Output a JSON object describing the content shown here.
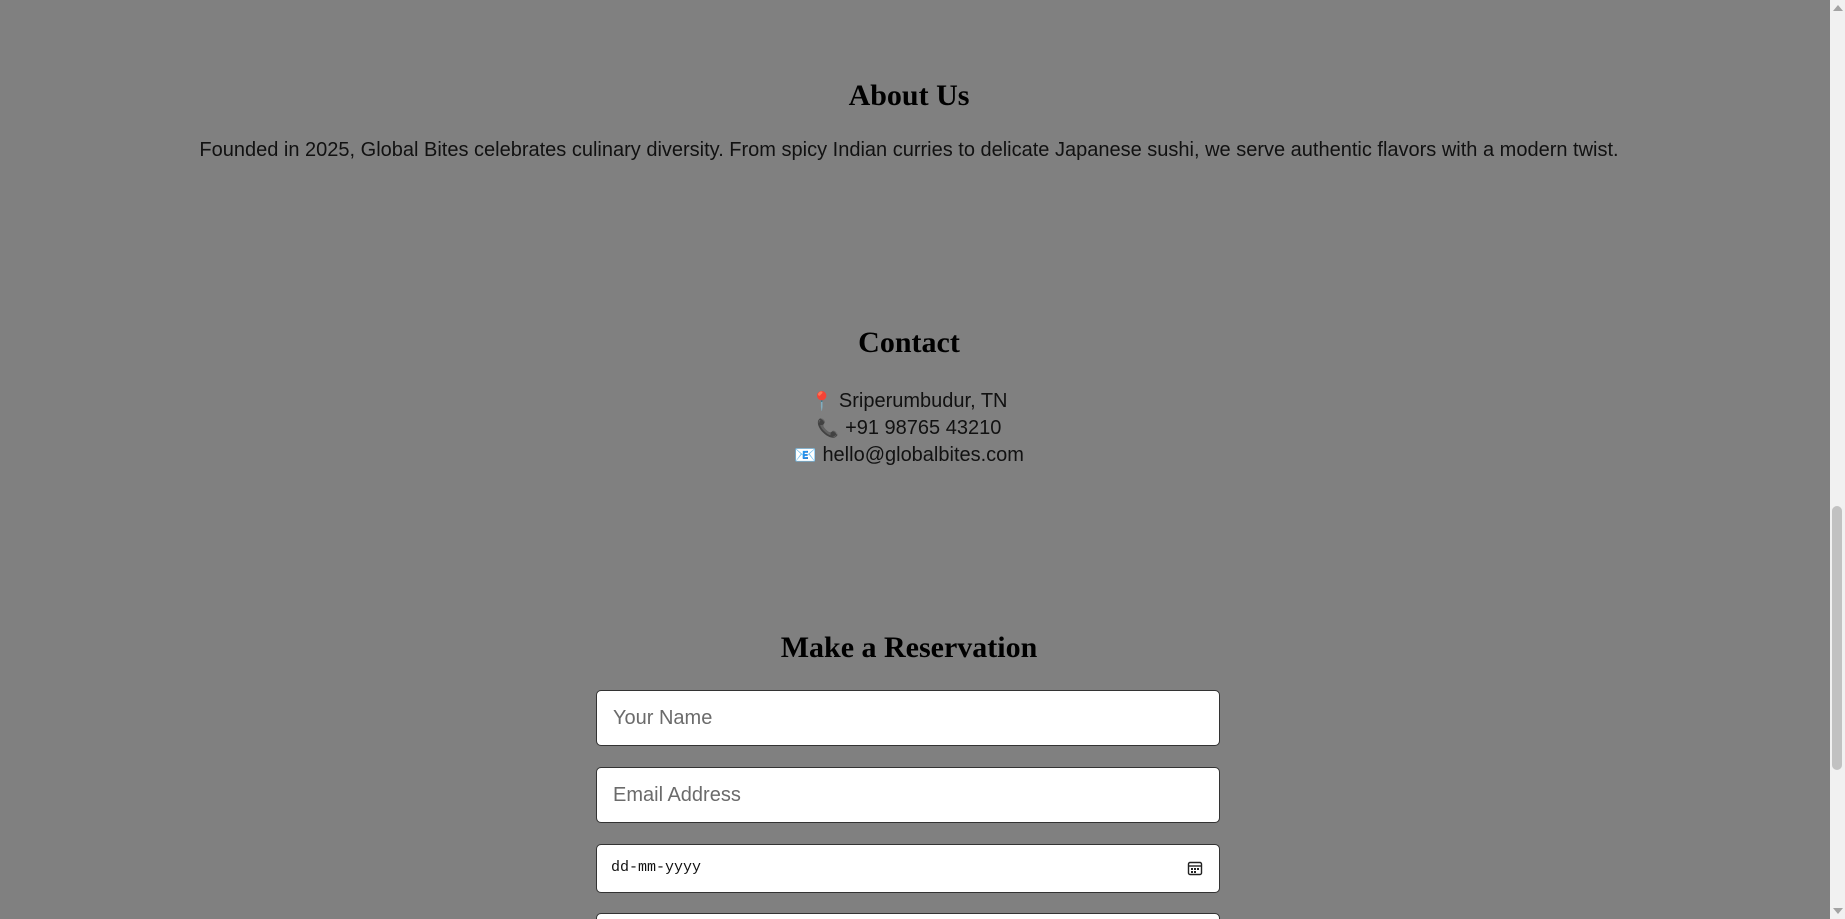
{
  "about": {
    "heading": "About Us",
    "text": "Founded in 2025, Global Bites celebrates culinary diversity. From spicy Indian curries to delicate Japanese sushi, we serve authentic flavors with a modern twist."
  },
  "contact": {
    "heading": "Contact",
    "items": [
      {
        "icon": "pin-icon",
        "glyph": "📍",
        "text": "Sriperumbudur, TN"
      },
      {
        "icon": "phone-icon",
        "glyph": "📞",
        "text": "+91 98765 43210"
      },
      {
        "icon": "mail-icon",
        "glyph": "📧",
        "text": "hello@globalbites.com"
      }
    ]
  },
  "reservation": {
    "heading": "Make a Reservation",
    "name_placeholder": "Your Name",
    "email_placeholder": "Email Address",
    "date_placeholder": "dd-mm-yyyy"
  },
  "colors": {
    "background": "#808080",
    "field_background": "#ffffff"
  }
}
